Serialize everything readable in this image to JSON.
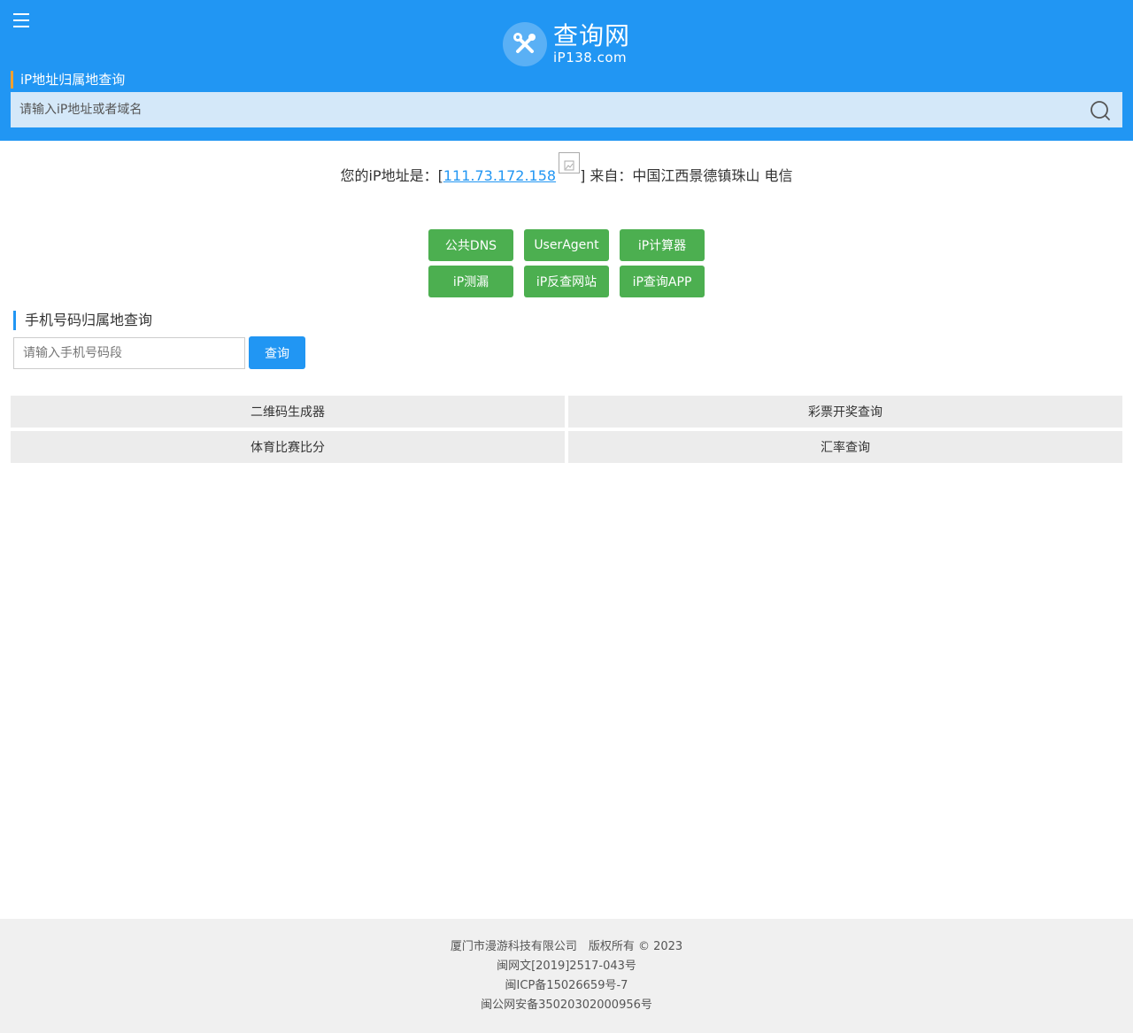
{
  "header": {
    "logo_cn": "查询网",
    "logo_en": "iP138.com",
    "section_label": "iP地址归属地查询",
    "search_placeholder": "请输入iP地址或者域名"
  },
  "ip_info": {
    "prefix": "您的iP地址是：[",
    "ip": "111.73.172.158",
    "suffix": "] 来自：中国江西景德镇珠山 电信"
  },
  "tools": [
    [
      "公共DNS",
      "UserAgent",
      "iP计算器"
    ],
    [
      "iP测漏",
      "iP反查网站",
      "iP查询APP"
    ]
  ],
  "phone": {
    "title": "手机号码归属地查询",
    "placeholder": "请输入手机号码段",
    "button": "查询"
  },
  "links": [
    "二维码生成器",
    "彩票开奖查询",
    "体育比赛比分",
    "汇率查询"
  ],
  "footer": {
    "line1": "厦门市漫游科技有限公司　版权所有 © 2023",
    "line2": "闽网文[2019]2517-043号",
    "line3": "闽ICP备15026659号-7",
    "line4": "闽公网安备35020302000956号"
  },
  "colors": {
    "header_bg": "#2196f3",
    "search_bg": "#d4e8f9",
    "green_button": "#4caf50",
    "label_accent": "#f0a030",
    "footer_bg": "#f0f0f0"
  }
}
